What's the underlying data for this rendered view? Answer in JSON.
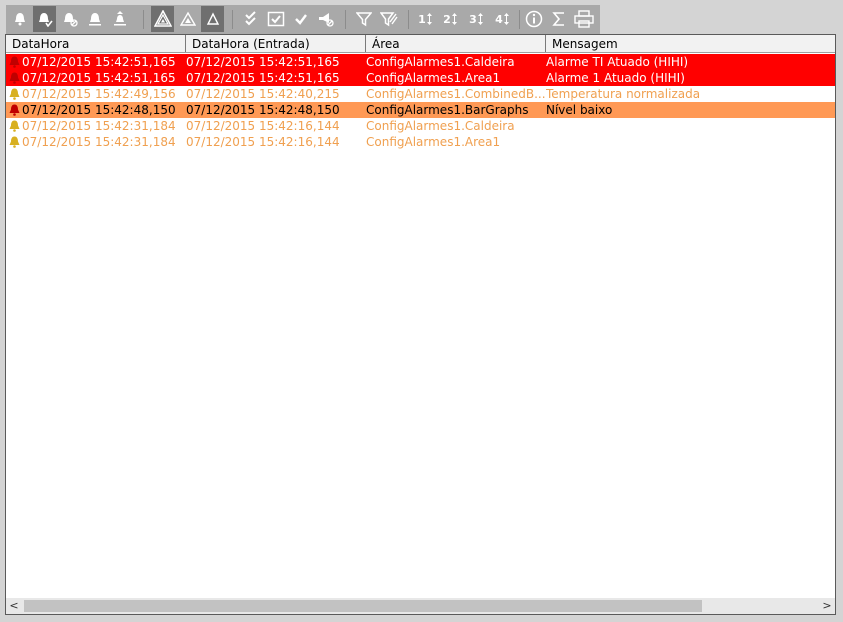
{
  "toolbar": {
    "buttons": [
      {
        "icon": "bell-icon"
      },
      {
        "icon": "bell-acknowledge-icon",
        "pressed": true
      },
      {
        "icon": "bell-disabled-icon"
      },
      {
        "icon": "bell-underline-icon"
      },
      {
        "icon": "bell-up-icon"
      },
      {
        "icon": "triangle-all-icon",
        "pressed": true
      },
      {
        "icon": "triangle-warning-icon"
      },
      {
        "icon": "triangle-outline-icon",
        "pressed": true
      },
      {
        "icon": "double-check-icon"
      },
      {
        "icon": "checkbox-icon"
      },
      {
        "icon": "check-icon"
      },
      {
        "icon": "megaphone-off-icon"
      },
      {
        "icon": "filter-icon"
      },
      {
        "icon": "filter-clear-icon"
      },
      {
        "icon": "sort-1-icon",
        "label": "1"
      },
      {
        "icon": "sort-2-icon",
        "label": "2"
      },
      {
        "icon": "sort-3-icon",
        "label": "3"
      },
      {
        "icon": "sort-4-icon",
        "label": "4"
      },
      {
        "icon": "info-icon"
      },
      {
        "icon": "sigma-icon"
      },
      {
        "icon": "print-icon"
      }
    ]
  },
  "grid": {
    "columns": [
      "DataHora",
      "DataHora (Entrada)",
      "Área",
      "Mensagem"
    ],
    "rows": [
      {
        "datahora": "07/12/2015 15:42:51,165",
        "entrada": "07/12/2015 15:42:51,165",
        "area": "ConfigAlarmes1.Caldeira",
        "mensagem": "Alarme TI Atuado (HIHI)",
        "bg": "#ff0000",
        "color": "#ffffff",
        "bell": "#c00000"
      },
      {
        "datahora": "07/12/2015 15:42:51,165",
        "entrada": "07/12/2015 15:42:51,165",
        "area": "ConfigAlarmes1.Area1",
        "mensagem": "Alarme 1 Atuado (HIHI)",
        "bg": "#ff0000",
        "color": "#ffffff",
        "bell": "#c00000"
      },
      {
        "datahora": "07/12/2015 15:42:49,156",
        "entrada": "07/12/2015 15:42:40,215",
        "area": "ConfigAlarmes1.CombinedB...",
        "mensagem": "Temperatura normalizada",
        "bg": "#ffffff",
        "color": "#f0a050",
        "bell": "#d8b020"
      },
      {
        "datahora": "07/12/2015 15:42:48,150",
        "entrada": "07/12/2015 15:42:48,150",
        "area": "ConfigAlarmes1.BarGraphs",
        "mensagem": "Nível baixo",
        "bg": "#ff9955",
        "color": "#000000",
        "bell": "#c00000"
      },
      {
        "datahora": "07/12/2015 15:42:31,184",
        "entrada": "07/12/2015 15:42:16,144",
        "area": "ConfigAlarmes1.Caldeira",
        "mensagem": "",
        "bg": "#ffffff",
        "color": "#f0a050",
        "bell": "#d8b020"
      },
      {
        "datahora": "07/12/2015 15:42:31,184",
        "entrada": "07/12/2015 15:42:16,144",
        "area": "ConfigAlarmes1.Area1",
        "mensagem": "",
        "bg": "#ffffff",
        "color": "#f0a050",
        "bell": "#d8b020"
      }
    ]
  },
  "scrollbar": {
    "left_arrow": "<",
    "right_arrow": ">"
  }
}
